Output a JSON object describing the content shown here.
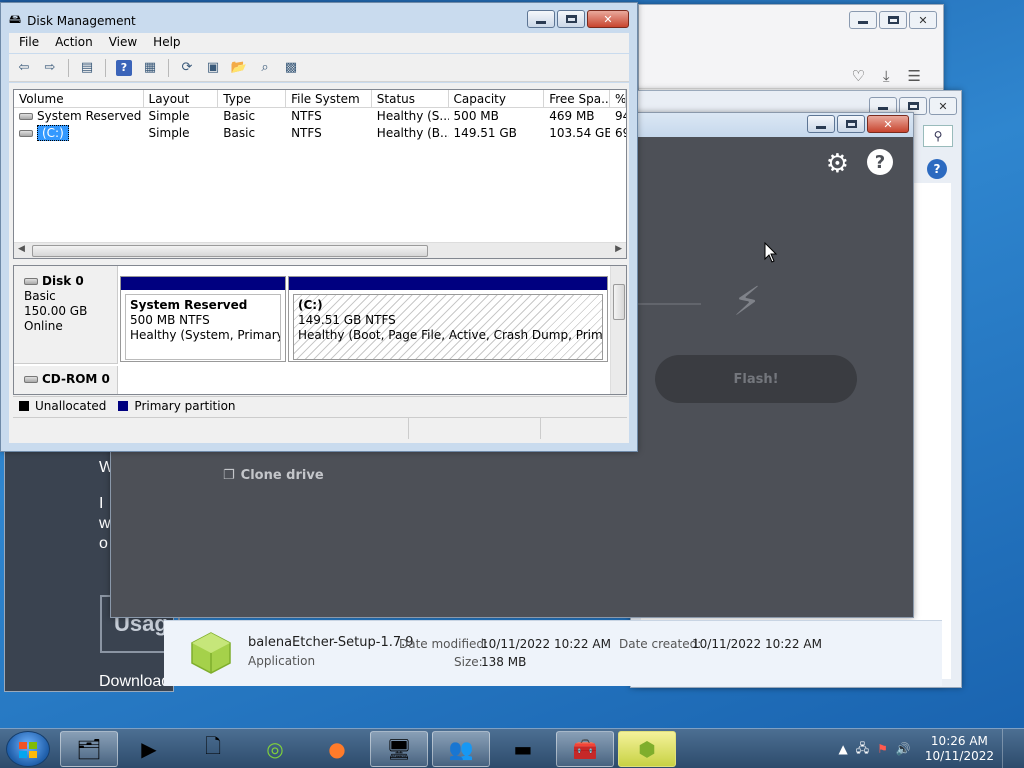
{
  "browser_bg": {
    "icons": [
      "pocket-icon",
      "download-icon",
      "menu-icon"
    ]
  },
  "webpage_bg": {
    "lines": [
      "W",
      "I",
      "w",
      "o"
    ],
    "usage_label": "Usag",
    "download_label": "Download"
  },
  "etcher": {
    "flash_label": "Flash!",
    "clone_label": "Clone drive"
  },
  "details_pane": {
    "name": "balenaEtcher-Setup-1.7.9",
    "kind": "Application",
    "date_modified_label": "Date modified:",
    "date_modified": "10/11/2022 10:22 AM",
    "date_created_label": "Date created:",
    "date_created": "10/11/2022 10:22 AM",
    "size_label": "Size:",
    "size": "138 MB"
  },
  "disk_mgmt": {
    "title": "Disk Management",
    "menu": [
      "File",
      "Action",
      "View",
      "Help"
    ],
    "columns": [
      "Volume",
      "Layout",
      "Type",
      "File System",
      "Status",
      "Capacity",
      "Free Spa...",
      "%"
    ],
    "rows": [
      {
        "volume": "System Reserved",
        "layout": "Simple",
        "type": "Basic",
        "fs": "NTFS",
        "status": "Healthy (S...",
        "capacity": "500 MB",
        "free": "469 MB",
        "pct": "94"
      },
      {
        "volume": "(C:)",
        "layout": "Simple",
        "type": "Basic",
        "fs": "NTFS",
        "status": "Healthy (B...",
        "capacity": "149.51 GB",
        "free": "103.54 GB",
        "pct": "69"
      }
    ],
    "disk0": {
      "name": "Disk 0",
      "kind": "Basic",
      "size": "150.00 GB",
      "state": "Online"
    },
    "partitions": [
      {
        "name": "System Reserved",
        "fs": "500 MB NTFS",
        "status": "Healthy (System, Primary Par"
      },
      {
        "name": "(C:)",
        "fs": "149.51 GB NTFS",
        "status": "Healthy (Boot, Page File, Active, Crash Dump, Primary Part"
      }
    ],
    "cdrom": "CD-ROM 0",
    "legend": {
      "unallocated": "Unallocated",
      "primary": "Primary partition"
    },
    "colors": {
      "unallocated": "#000000",
      "primary": "#000080"
    }
  },
  "taskbar": {
    "clock_time": "10:26 AM",
    "clock_date": "10/11/2022"
  }
}
